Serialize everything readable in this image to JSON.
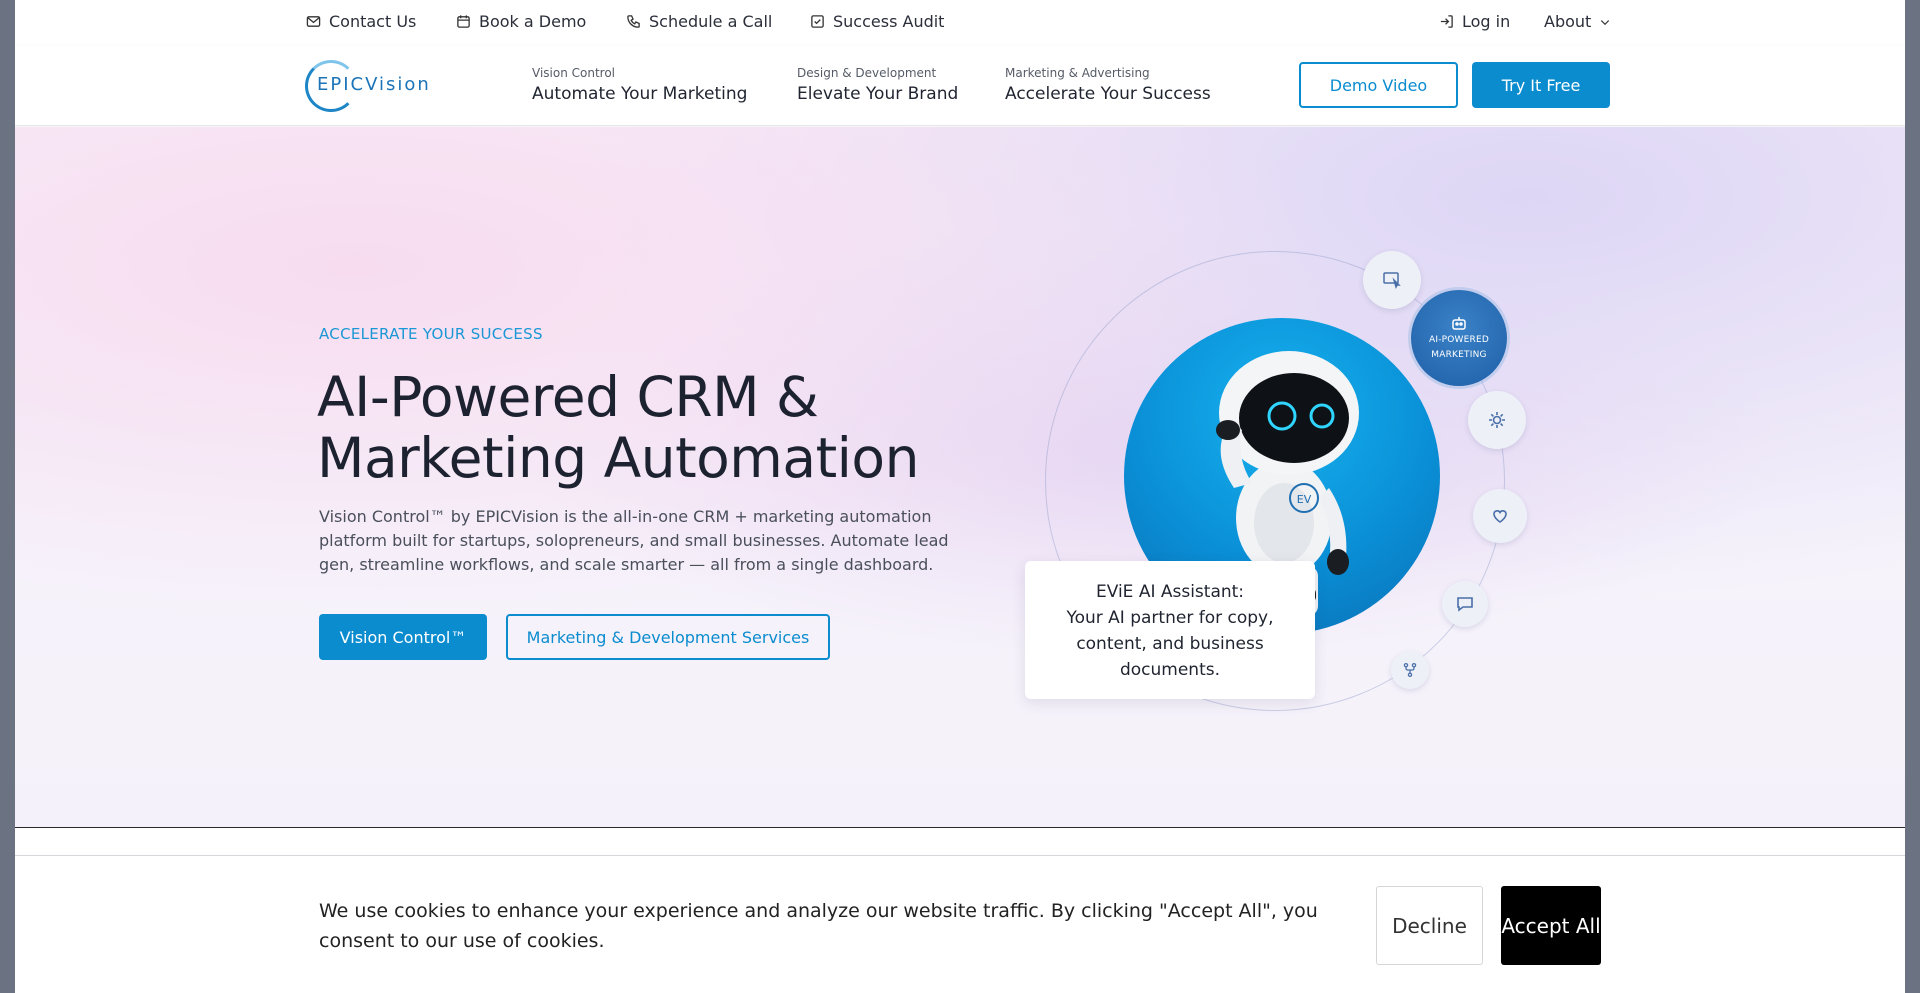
{
  "topbar": {
    "contact": "Contact Us",
    "book_demo": "Book a Demo",
    "schedule_call": "Schedule a Call",
    "success_audit": "Success Audit",
    "login": "Log in",
    "about": "About"
  },
  "nav": {
    "logo_text": "EPICVision",
    "items": [
      {
        "small": "Vision Control",
        "big": "Automate Your Marketing"
      },
      {
        "small": "Design & Development",
        "big": "Elevate Your Brand"
      },
      {
        "small": "Marketing & Advertising",
        "big": "Accelerate Your Success"
      }
    ],
    "demo_video": "Demo Video",
    "try_free": "Try It Free"
  },
  "hero": {
    "eyebrow": "ACCELERATE YOUR SUCCESS",
    "title": "AI-Powered CRM & Marketing Automation",
    "description": "Vision Control™ by EPICVision is the all-in-one CRM + marketing automation platform built for startups, solopreneurs, and small businesses. Automate lead gen, streamline workflows, and scale smarter — all from a single dashboard.",
    "btn_primary": "Vision Control™",
    "btn_secondary": "Marketing & Development Services"
  },
  "illustration": {
    "badge_line1": "AI-POWERED",
    "badge_line2": "MARKETING",
    "robot_chest_logo": "EV",
    "card_line1": "EViE AI Assistant:",
    "card_line2": "Your AI partner for copy, content, and business documents."
  },
  "cookie": {
    "text": "We use cookies to enhance your experience and analyze our website traffic. By clicking \"Accept All\", you consent to our use of cookies.",
    "decline": "Decline",
    "accept": "Accept All"
  },
  "colors": {
    "accent": "#0a8ccf",
    "dark_text": "#1d2230"
  }
}
